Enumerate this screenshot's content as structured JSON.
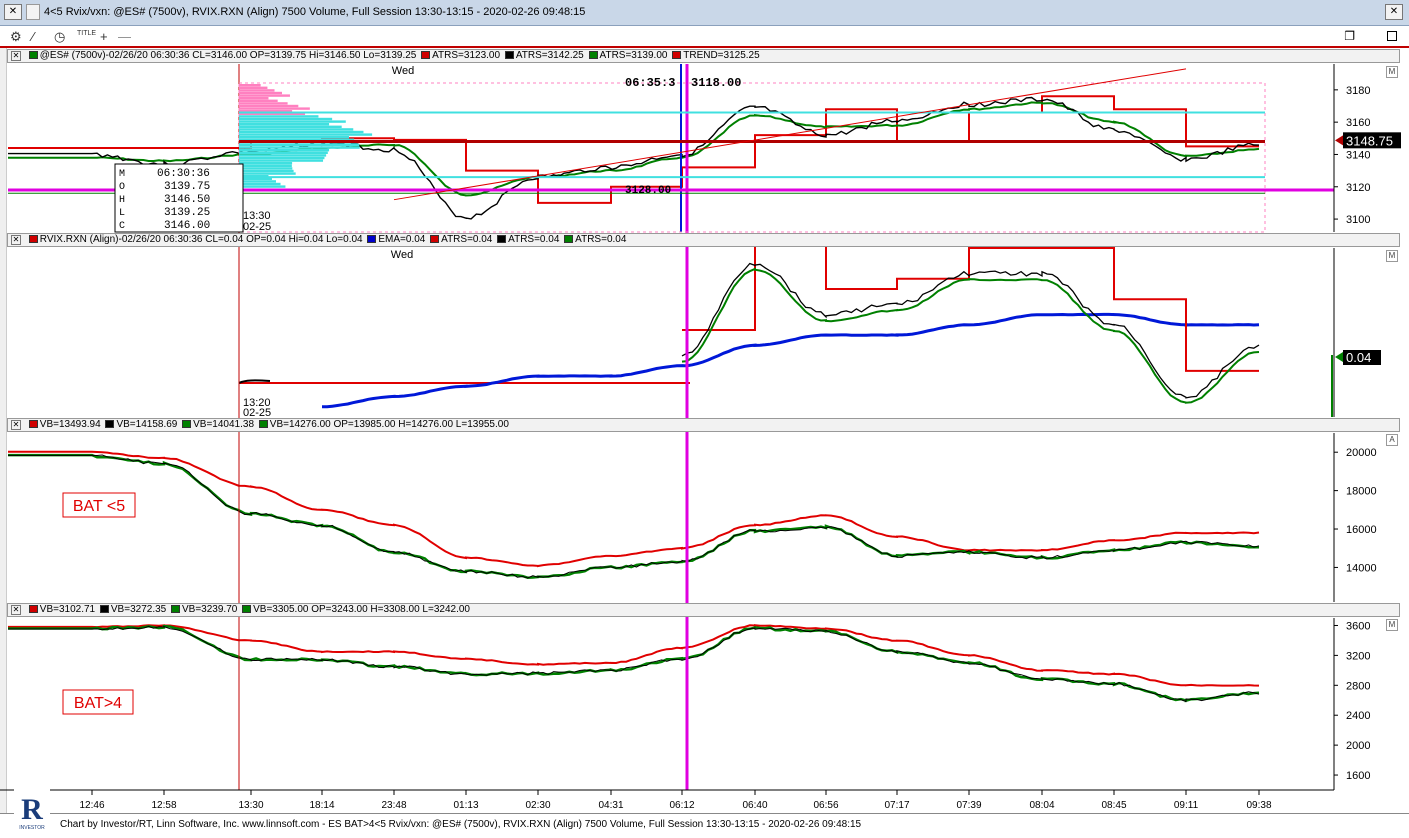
{
  "window": {
    "title": "4<5 Rvix/vxn: @ES# (7500v), RVIX.RXN (Align) 7500 Volume, Full Session 13:30-13:15 - 2020-02-26 09:48:15",
    "close_glyph": "✕"
  },
  "toolbar": {
    "icons": [
      "gear-icon",
      "pencil-icon",
      "clock-icon",
      "title-icon",
      "crosshair-icon",
      "restore-icon",
      "maximize-icon"
    ],
    "title_label": "TITLE"
  },
  "panes": [
    {
      "id": "es",
      "header": [
        "@ES# (7500v)-02/26/20 06:30:36 CL=3146.00 OP=3139.75 Hi=3146.50 Lo=3139.25",
        "ATRS=3123.00",
        "ATRS=3142.25",
        "ATRS=3139.00",
        "TREND=3125.25"
      ],
      "header_colors": [
        "#008000",
        "#d00000",
        "#000000",
        "#008000",
        "#d00000"
      ],
      "day_label": "Wed",
      "corner_button": "M",
      "price_ticks": [
        "3180",
        "3160",
        "3140",
        "3120",
        "3100"
      ],
      "last_price": "3148.75",
      "cursor_time": "06:35:3",
      "cursor_price": "3118.00",
      "level_label": "3128.00",
      "ohlc_box": {
        "time": "06:30:36",
        "labels": [
          "M",
          "O",
          "H",
          "L",
          "C"
        ],
        "values": [
          "",
          "3139.75",
          "3146.50",
          "3139.25",
          "3146.00"
        ]
      },
      "side_label_time": "13:30",
      "side_label_date": "02-25"
    },
    {
      "id": "rvix",
      "header": [
        "RVIX.RXN (Align)-02/26/20 06:30:36 CL=0.04 OP=0.04 Hi=0.04 Lo=0.04",
        "EMA=0.04",
        "ATRS=0.04",
        "ATRS=0.04",
        "ATRS=0.04"
      ],
      "header_colors": [
        "#d00000",
        "#0000cc",
        "#d00000",
        "#000000",
        "#008000"
      ],
      "day_label": "Wed",
      "corner_button": "M",
      "last_price": "0.04",
      "side_label_time": "13:20",
      "side_label_date": "02-25"
    },
    {
      "id": "bat5",
      "header": [
        "VB=13493.94",
        "VB=14158.69",
        "VB=14041.38",
        "VB=14276.00 OP=13985.00 H=14276.00 L=13955.00"
      ],
      "header_colors": [
        "#d00000",
        "#000000",
        "#008000",
        "#008000"
      ],
      "corner_button": "A",
      "price_ticks": [
        "20000",
        "18000",
        "16000",
        "14000"
      ],
      "label": "BAT <5"
    },
    {
      "id": "bat4",
      "header": [
        "VB=3102.71",
        "VB=3272.35",
        "VB=3239.70",
        "VB=3305.00 OP=3243.00 H=3308.00 L=3242.00"
      ],
      "header_colors": [
        "#d00000",
        "#000000",
        "#008000",
        "#008000"
      ],
      "corner_button": "M",
      "price_ticks": [
        "3600",
        "3200",
        "2800",
        "2400",
        "2000",
        "1600"
      ],
      "label": "BAT>4"
    }
  ],
  "time_axis": [
    "12:46",
    "12:58",
    "13:30",
    "18:14",
    "23:48",
    "01:13",
    "02:30",
    "04:31",
    "06:12",
    "06:40",
    "06:56",
    "07:17",
    "07:39",
    "08:04",
    "08:45",
    "09:11",
    "09:38"
  ],
  "footer": {
    "caption": "Chart by Investor/RT, Linn Software, Inc. www.linnsoft.com - ES BAT>4<5 Rvix/vxn: @ES# (7500v), RVIX.RXN (Align) 7500 Volume, Full Session 13:30-13:15 - 2020-02-26 09:48:15",
    "logo_letter": "R",
    "logo_text": "INVESTOR"
  },
  "colors": {
    "red": "#e00000",
    "green": "#008000",
    "black": "#000000",
    "blue": "#0018d8",
    "magenta": "#e000e0",
    "cyan": "#40e0e0",
    "pink": "#ff80c0",
    "darkred": "#b00000"
  },
  "chart_data": [
    {
      "type": "line",
      "title": "@ES# (7500v)",
      "x": [
        "12:46",
        "12:58",
        "13:30",
        "18:14",
        "23:48",
        "01:13",
        "02:30",
        "04:31",
        "06:12",
        "06:40",
        "06:56",
        "07:17",
        "07:39",
        "08:04",
        "08:45",
        "09:11",
        "09:38"
      ],
      "ylim": [
        3092,
        3196
      ],
      "series": [
        {
          "name": "@ES# (7500v)",
          "values": [
            3140,
            3134,
            3142,
            3147,
            3143,
            3101,
            3126,
            3132,
            3140,
            3169,
            3152,
            3161,
            3171,
            3174,
            3155,
            3137,
            3146
          ]
        },
        {
          "name": "ATRS=3123.00",
          "values": [
            3144,
            3144,
            3148,
            3150,
            3149,
            3130,
            3110,
            3120,
            3132,
            3152,
            3168,
            3148,
            3166,
            3176,
            3168,
            3145,
            3137
          ]
        },
        {
          "name": "ATRS=3139.00",
          "values": [
            3138,
            3136,
            3140,
            3144,
            3146,
            3115,
            3126,
            3130,
            3138,
            3164,
            3157,
            3158,
            3168,
            3172,
            3160,
            3139,
            3143
          ]
        }
      ],
      "trend_line": {
        "name": "TREND=3125.25",
        "from": [
          "23:48",
          3112
        ],
        "to": [
          "09:38",
          3193
        ]
      },
      "horizontal_levels": [
        3166,
        3148,
        3118,
        3126
      ]
    },
    {
      "type": "line",
      "title": "RVIX.RXN (Align)",
      "x": [
        "12:46",
        "12:58",
        "13:30",
        "18:14",
        "23:48",
        "01:13",
        "02:30",
        "04:31",
        "06:12",
        "06:40",
        "06:56",
        "07:17",
        "07:39",
        "08:04",
        "08:45",
        "09:11",
        "09:38"
      ],
      "series": [
        {
          "name": "RVIX.RXN (Align)",
          "values": [
            null,
            null,
            null,
            null,
            null,
            null,
            null,
            null,
            0.038,
            0.047,
            0.042,
            0.043,
            0.046,
            0.046,
            0.041,
            0.034,
            0.039
          ]
        },
        {
          "name": "EMA=0.04",
          "values": [
            null,
            null,
            null,
            0.033,
            0.034,
            0.035,
            0.036,
            0.036,
            0.037,
            0.039,
            0.04,
            0.04,
            0.041,
            0.042,
            0.042,
            0.041,
            0.041
          ]
        }
      ]
    },
    {
      "type": "line",
      "title": "BAT <5",
      "x": [
        "12:46",
        "12:58",
        "13:30",
        "18:14",
        "23:48",
        "01:13",
        "02:30",
        "04:31",
        "06:12",
        "06:40",
        "06:56",
        "07:17",
        "07:39",
        "08:04",
        "08:45",
        "09:11",
        "09:38"
      ],
      "ylim": [
        12200,
        21000
      ],
      "series": [
        {
          "name": "VB=13493.94",
          "values": [
            20000,
            19700,
            18200,
            17000,
            16200,
            14500,
            14100,
            14600,
            15000,
            16200,
            16700,
            15600,
            14900,
            14900,
            15400,
            15800,
            15800
          ]
        },
        {
          "name": "VB=14041.38",
          "values": [
            19800,
            19400,
            16800,
            16200,
            14800,
            13800,
            13500,
            14000,
            14300,
            15900,
            16100,
            14600,
            14800,
            14500,
            14900,
            15300,
            15100
          ]
        }
      ]
    },
    {
      "type": "line",
      "title": "BAT>4",
      "x": [
        "12:46",
        "12:58",
        "13:30",
        "18:14",
        "23:48",
        "01:13",
        "02:30",
        "04:31",
        "06:12",
        "06:40",
        "06:56",
        "07:17",
        "07:39",
        "08:04",
        "08:45",
        "09:11",
        "09:38"
      ],
      "ylim": [
        1400,
        3700
      ],
      "series": [
        {
          "name": "VB=3102.71",
          "values": [
            3580,
            3600,
            3400,
            3250,
            3250,
            3150,
            3080,
            3100,
            3300,
            3600,
            3560,
            3400,
            3200,
            3000,
            2950,
            2800,
            2800
          ]
        },
        {
          "name": "VB=3239.70",
          "values": [
            3560,
            3580,
            3150,
            3140,
            3050,
            2950,
            2960,
            3000,
            3150,
            3560,
            3520,
            3250,
            3100,
            2880,
            2820,
            2600,
            2700
          ]
        }
      ]
    }
  ]
}
